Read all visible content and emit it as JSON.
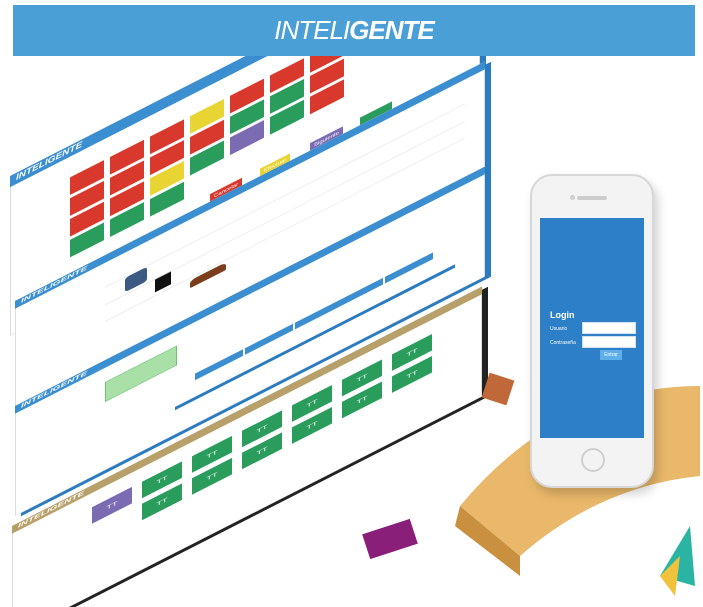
{
  "banner": {
    "brand_thin": "INTELI",
    "brand_bold": "GENTE",
    "color": "#4a9fd6"
  },
  "colors": {
    "accent_blue": "#3b8fd0",
    "tile_red": "#d9382c",
    "tile_green": "#2a9d5c",
    "tile_yellow": "#e8d534",
    "tile_purple": "#7a6bb2",
    "pedestal": "#e9b86a"
  },
  "layer1": {
    "brand": "INTELIGENTE",
    "button_cancel": "Cancelar",
    "button_confirm": "Efectuar",
    "button_next": "Siguiente"
  },
  "layer4": {
    "brand": "INTELIGENTE",
    "tile_label": "TT"
  },
  "phone": {
    "login_title": "Login",
    "user_label": "Usuario",
    "pass_label": "Contraseña",
    "login_button": "Entrar"
  }
}
